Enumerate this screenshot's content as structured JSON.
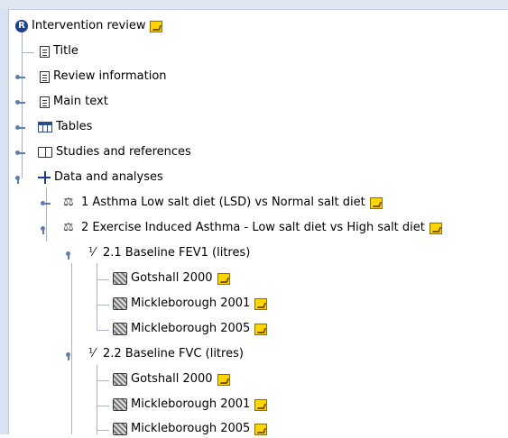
{
  "tree": {
    "root": {
      "label": "Intervention review",
      "icon": "r-logo-icon"
    },
    "items": [
      {
        "label": "Title",
        "icon": "document-icon"
      },
      {
        "label": "Review information",
        "icon": "document-icon"
      },
      {
        "label": "Main text",
        "icon": "pages-icon"
      },
      {
        "label": "Tables",
        "icon": "table-icon"
      },
      {
        "label": "Studies and references",
        "icon": "book-icon"
      },
      {
        "label": "Data and analyses",
        "icon": "data-icon"
      }
    ],
    "comparisons": [
      {
        "label": "1 Asthma Low salt diet (LSD) vs Normal salt diet"
      },
      {
        "label": "2 Exercise Induced Asthma - Low salt diet vs High salt diet"
      }
    ],
    "outcomes": [
      {
        "label": "2.1 Baseline FEV1 (litres)",
        "studies": [
          "Gotshall 2000",
          "Mickleborough 2001",
          "Mickleborough 2005"
        ]
      },
      {
        "label": "2.2 Baseline FVC (litres)",
        "studies": [
          "Gotshall 2000",
          "Mickleborough 2001",
          "Mickleborough 2005"
        ]
      }
    ]
  },
  "colors": {
    "note": "#ffd400",
    "connector": "#aab4c6",
    "handle": "#5b7fb5",
    "gutter": "#d9e3f2"
  }
}
